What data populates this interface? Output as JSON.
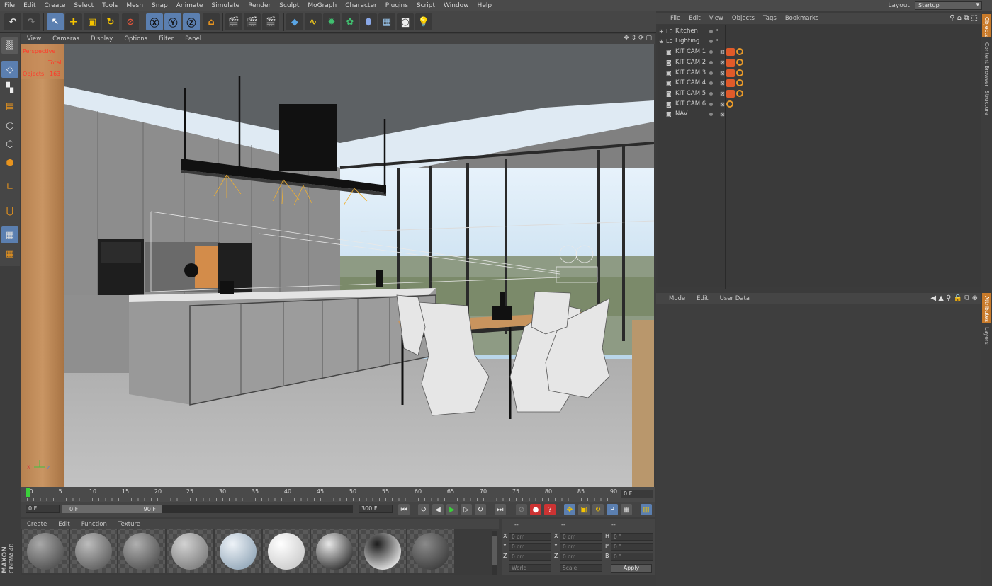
{
  "menu": [
    "File",
    "Edit",
    "Create",
    "Select",
    "Tools",
    "Mesh",
    "Snap",
    "Animate",
    "Simulate",
    "Render",
    "Sculpt",
    "MoGraph",
    "Character",
    "Plugins",
    "Script",
    "Window",
    "Help"
  ],
  "layout": {
    "label": "Layout:",
    "value": "Startup"
  },
  "viewport": {
    "menu": [
      "View",
      "Cameras",
      "Display",
      "Options",
      "Filter",
      "Panel"
    ],
    "hud_mode": "Perspective",
    "hud_total": "Total",
    "hud_objects": "Objects",
    "hud_count": "163"
  },
  "timeline": {
    "ticks": [
      "0",
      "5",
      "10",
      "15",
      "20",
      "25",
      "30",
      "35",
      "40",
      "45",
      "50",
      "55",
      "60",
      "65",
      "70",
      "75",
      "80",
      "85",
      "90"
    ],
    "current_frame_box": "0 F"
  },
  "transport": {
    "start_field": "0 F",
    "range_start": "0 F",
    "range_end": "90 F",
    "end_field": "300 F"
  },
  "materials_menu": [
    "Create",
    "Edit",
    "Function",
    "Texture"
  ],
  "materials": [
    {
      "colors": [
        "#a9a9a9",
        "#4d4d4d"
      ]
    },
    {
      "colors": [
        "#bdbdbd",
        "#5b5b5b"
      ]
    },
    {
      "colors": [
        "#b0b0b0",
        "#505050"
      ]
    },
    {
      "colors": [
        "#d2d2d2",
        "#7a7a7a"
      ]
    },
    {
      "colors": [
        "#eef3f8",
        "#8fa4b6"
      ]
    },
    {
      "colors": [
        "#ffffff",
        "#c9c9c9"
      ]
    },
    {
      "colors": [
        "#e8e8e8",
        "#2a2a2a"
      ]
    },
    {
      "colors": [
        "#1c1c1c",
        "#f2f2f2"
      ]
    },
    {
      "colors": [
        "#8a8a8a",
        "#3a3a3a"
      ]
    }
  ],
  "coords": {
    "header": [
      "--",
      "--",
      "--"
    ],
    "rows": [
      {
        "a": "X",
        "av": "0 cm",
        "b": "X",
        "bv": "0 cm",
        "c": "H",
        "cv": "0 °"
      },
      {
        "a": "Y",
        "av": "0 cm",
        "b": "Y",
        "bv": "0 cm",
        "c": "P",
        "cv": "0 °"
      },
      {
        "a": "Z",
        "av": "0 cm",
        "b": "Z",
        "bv": "0 cm",
        "c": "B",
        "cv": "0 °"
      }
    ],
    "world": "World",
    "scale": "Scale",
    "apply": "Apply"
  },
  "logo": {
    "brand": "MAXON",
    "product": "CINEMA 4D"
  },
  "objects_menu": [
    "File",
    "Edit",
    "View",
    "Objects",
    "Tags",
    "Bookmarks"
  ],
  "objects": [
    {
      "name": "Kitchen",
      "type": "layer",
      "tags": []
    },
    {
      "name": "Lighting",
      "type": "layer",
      "tags": []
    },
    {
      "name": "KIT CAM 1",
      "type": "camera",
      "tags": [
        "cam",
        "ban"
      ]
    },
    {
      "name": "KIT CAM 2",
      "type": "camera",
      "tags": [
        "cam",
        "ban"
      ]
    },
    {
      "name": "KIT CAM 3",
      "type": "camera",
      "tags": [
        "cam",
        "ban"
      ]
    },
    {
      "name": "KIT CAM 4",
      "type": "camera",
      "tags": [
        "cam",
        "ban"
      ]
    },
    {
      "name": "KIT CAM 5",
      "type": "camera",
      "tags": [
        "cam",
        "ban"
      ]
    },
    {
      "name": "KIT CAM 6",
      "type": "camera",
      "tags": [
        "ban"
      ]
    },
    {
      "name": "NAV",
      "type": "camera",
      "tags": []
    }
  ],
  "side_tabs_top": [
    "Objects",
    "Content Browser",
    "Structure"
  ],
  "side_tabs_bottom": [
    "Attributes",
    "Layers"
  ],
  "attributes_menu": [
    "Mode",
    "Edit",
    "User Data"
  ],
  "colors": {
    "accent": "#5b7fb0",
    "play": "#3bd13b",
    "hud": "#ff3a2a",
    "tag_cam": "#e05a2a"
  }
}
